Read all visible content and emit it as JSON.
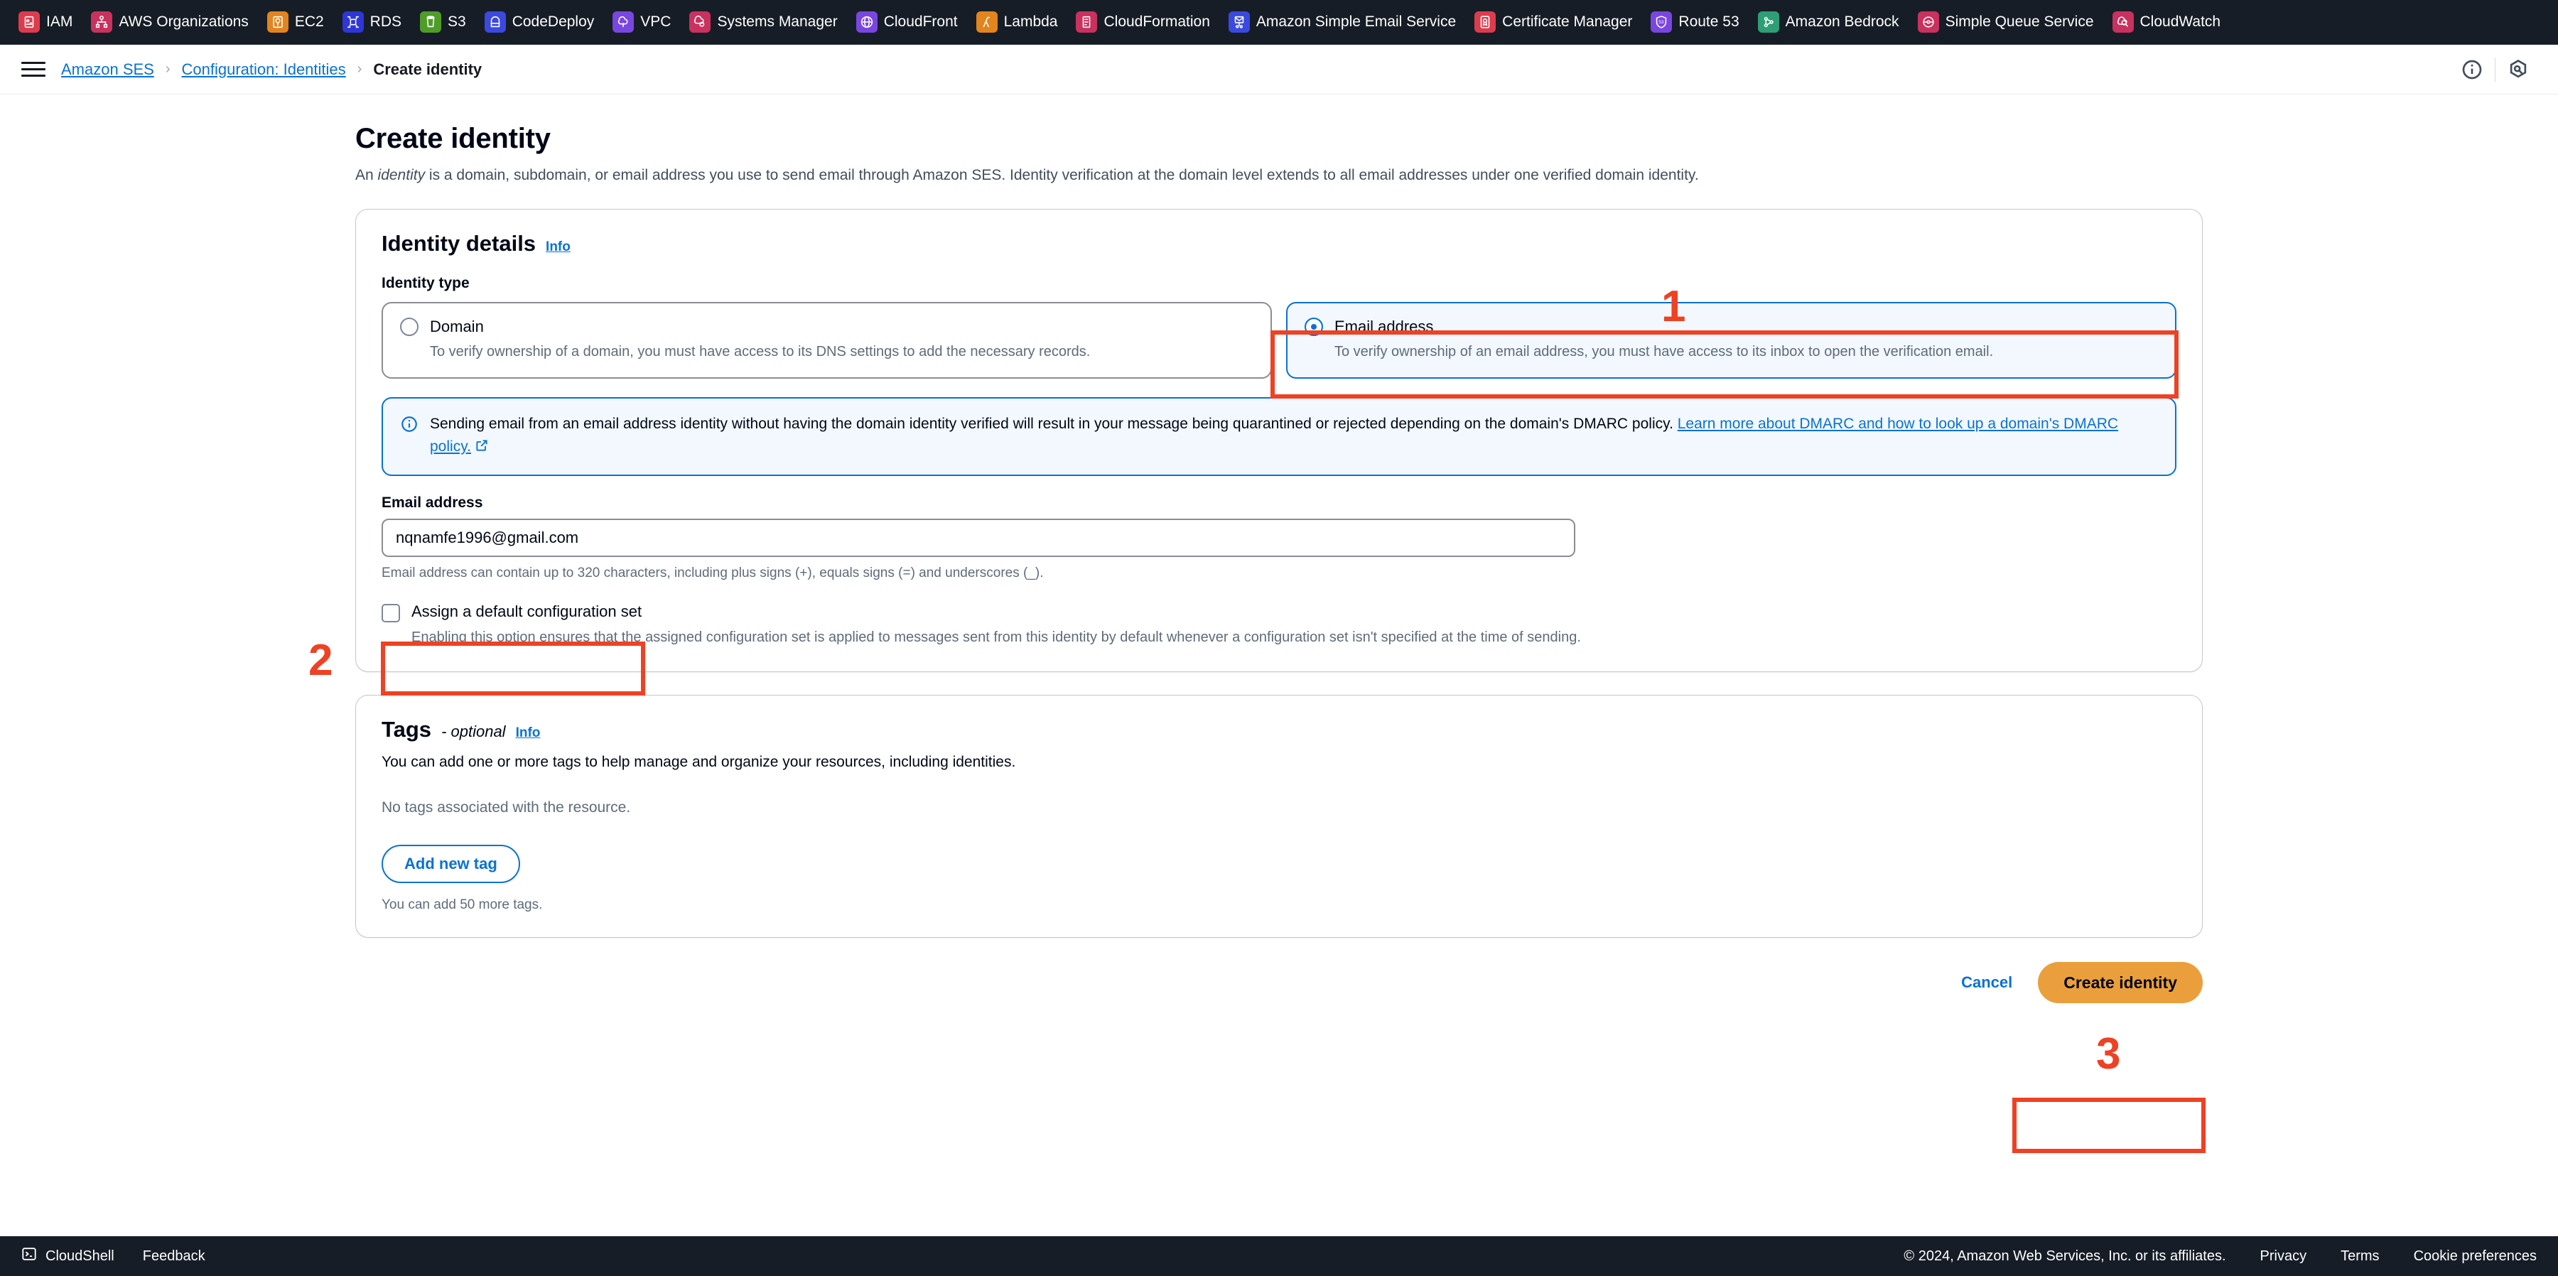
{
  "services_bar": [
    {
      "label": "IAM",
      "icon": "iam-icon",
      "color": "#dd3c4e"
    },
    {
      "label": "AWS Organizations",
      "icon": "organizations-icon",
      "color": "#c9315f"
    },
    {
      "label": "EC2",
      "icon": "ec2-icon",
      "color": "#e2851e"
    },
    {
      "label": "RDS",
      "icon": "rds-icon",
      "color": "#2e37d6"
    },
    {
      "label": "S3",
      "icon": "s3-icon",
      "color": "#4f9c29"
    },
    {
      "label": "CodeDeploy",
      "icon": "codedeploy-icon",
      "color": "#3b49df"
    },
    {
      "label": "VPC",
      "icon": "vpc-icon",
      "color": "#7a46e0"
    },
    {
      "label": "Systems Manager",
      "icon": "systems-manager-icon",
      "color": "#c9315f"
    },
    {
      "label": "CloudFront",
      "icon": "cloudfront-icon",
      "color": "#7a46e0"
    },
    {
      "label": "Lambda",
      "icon": "lambda-icon",
      "color": "#e2851e"
    },
    {
      "label": "CloudFormation",
      "icon": "cloudformation-icon",
      "color": "#c9315f"
    },
    {
      "label": "Amazon Simple Email Service",
      "icon": "ses-icon",
      "color": "#3b49df"
    },
    {
      "label": "Certificate Manager",
      "icon": "certificate-manager-icon",
      "color": "#dd3c4e"
    },
    {
      "label": "Route 53",
      "icon": "route53-icon",
      "color": "#7a46e0"
    },
    {
      "label": "Amazon Bedrock",
      "icon": "bedrock-icon",
      "color": "#2e9e76"
    },
    {
      "label": "Simple Queue Service",
      "icon": "sqs-icon",
      "color": "#c9315f"
    },
    {
      "label": "CloudWatch",
      "icon": "cloudwatch-icon",
      "color": "#c9315f"
    }
  ],
  "breadcrumb": {
    "items": [
      {
        "label": "Amazon SES",
        "current": false
      },
      {
        "label": "Configuration: Identities",
        "current": false
      },
      {
        "label": "Create identity",
        "current": true
      }
    ],
    "separator": "›",
    "info_icon": "info-circle-icon",
    "settings_icon": "settings-hex-icon"
  },
  "page": {
    "title": "Create identity",
    "description_before": "An ",
    "description_em": "identity",
    "description_after": " is a domain, subdomain, or email address you use to send email through Amazon SES. Identity verification at the domain level extends to all email addresses under one verified domain identity."
  },
  "identity_details": {
    "title": "Identity details",
    "info_label": "Info",
    "identity_type_label": "Identity type",
    "options": [
      {
        "title": "Domain",
        "description": "To verify ownership of a domain, you must have access to its DNS settings to add the necessary records.",
        "selected": false
      },
      {
        "title": "Email address",
        "description": "To verify ownership of an email address, you must have access to its inbox to open the verification email.",
        "selected": true
      }
    ],
    "alert": {
      "icon": "info-circle-icon",
      "text": "Sending email from an email address identity without having the domain identity verified will result in your message being quarantined or rejected depending on the domain's DMARC policy. ",
      "link_text": "Learn more about DMARC and how to look up a domain's DMARC policy.",
      "external_icon": "external-link-icon"
    },
    "email_field": {
      "label": "Email address",
      "value": "nqnamfe1996@gmail.com",
      "placeholder": "",
      "hint": "Email address can contain up to 320 characters, including plus signs (+), equals signs (=) and underscores (_)."
    },
    "config_set_checkbox": {
      "label": "Assign a default configuration set",
      "description": "Enabling this option ensures that the assigned configuration set is applied to messages sent from this identity by default whenever a configuration set isn't specified at the time of sending.",
      "checked": false
    }
  },
  "tags": {
    "title": "Tags",
    "optional_label": "- optional",
    "info_label": "Info",
    "description": "You can add one or more tags to help manage and organize your resources, including identities.",
    "empty_text": "No tags associated with the resource.",
    "add_button": "Add new tag",
    "footnote": "You can add 50 more tags."
  },
  "actions": {
    "cancel_label": "Cancel",
    "create_label": "Create identity"
  },
  "annotations": {
    "step1": "1",
    "step2": "2",
    "step3": "3",
    "color": "#ef4123"
  },
  "footer": {
    "cloudshell": "CloudShell",
    "feedback": "Feedback",
    "copyright": "© 2024, Amazon Web Services, Inc. or its affiliates.",
    "privacy": "Privacy",
    "terms": "Terms",
    "cookie_preferences": "Cookie preferences"
  }
}
